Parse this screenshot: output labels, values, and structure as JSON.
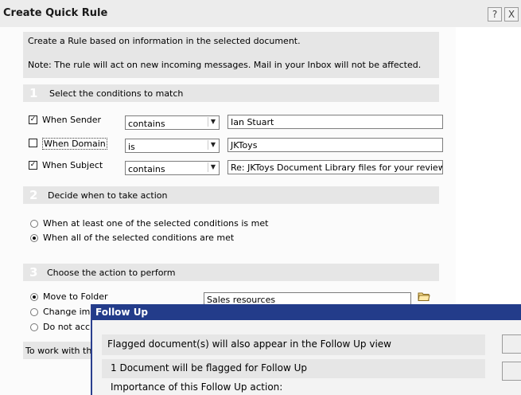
{
  "window": {
    "title": "Create Quick Rule",
    "help_glyph": "?",
    "close_glyph": "X"
  },
  "intro": {
    "line1": "Create a Rule based on information in the selected document.",
    "line2": "Note: The rule will act on new incoming messages. Mail in your Inbox will not be affected."
  },
  "section1": {
    "number": "1",
    "title": "Select the conditions to match",
    "conditions": [
      {
        "label": "When Sender",
        "checked": true,
        "operator": "contains",
        "value": "Ian Stuart"
      },
      {
        "label": "When Domain",
        "checked": false,
        "operator": "is",
        "value": "JKToys"
      },
      {
        "label": "When Subject",
        "checked": true,
        "operator": "contains",
        "value": "Re: JKToys Document Library files for your review"
      }
    ]
  },
  "section2": {
    "number": "2",
    "title": "Decide when to take action",
    "options": [
      {
        "label": "When at least one of the selected conditions is met",
        "selected": false
      },
      {
        "label": "When all of the selected conditions are met",
        "selected": true
      }
    ]
  },
  "section3": {
    "number": "3",
    "title": "Choose the action to perform",
    "actions": [
      {
        "label": "Move to Folder",
        "selected": true
      },
      {
        "label": "Change im",
        "selected": false
      },
      {
        "label": "Do not acc",
        "selected": false
      }
    ],
    "folder_value": "Sales resources"
  },
  "footer_text": "To work with th",
  "check_glyph": "✓",
  "dropdown_glyph": "▼",
  "follow_up": {
    "title": "Follow Up",
    "line1": "Flagged document(s) will also appear in the Follow Up view",
    "line2": "1 Document will be flagged for Follow Up",
    "line3": "Importance of this Follow Up action:"
  },
  "colors": {
    "dialog_title_bg": "#233c8a",
    "section_bar": "#e6e6e6"
  }
}
